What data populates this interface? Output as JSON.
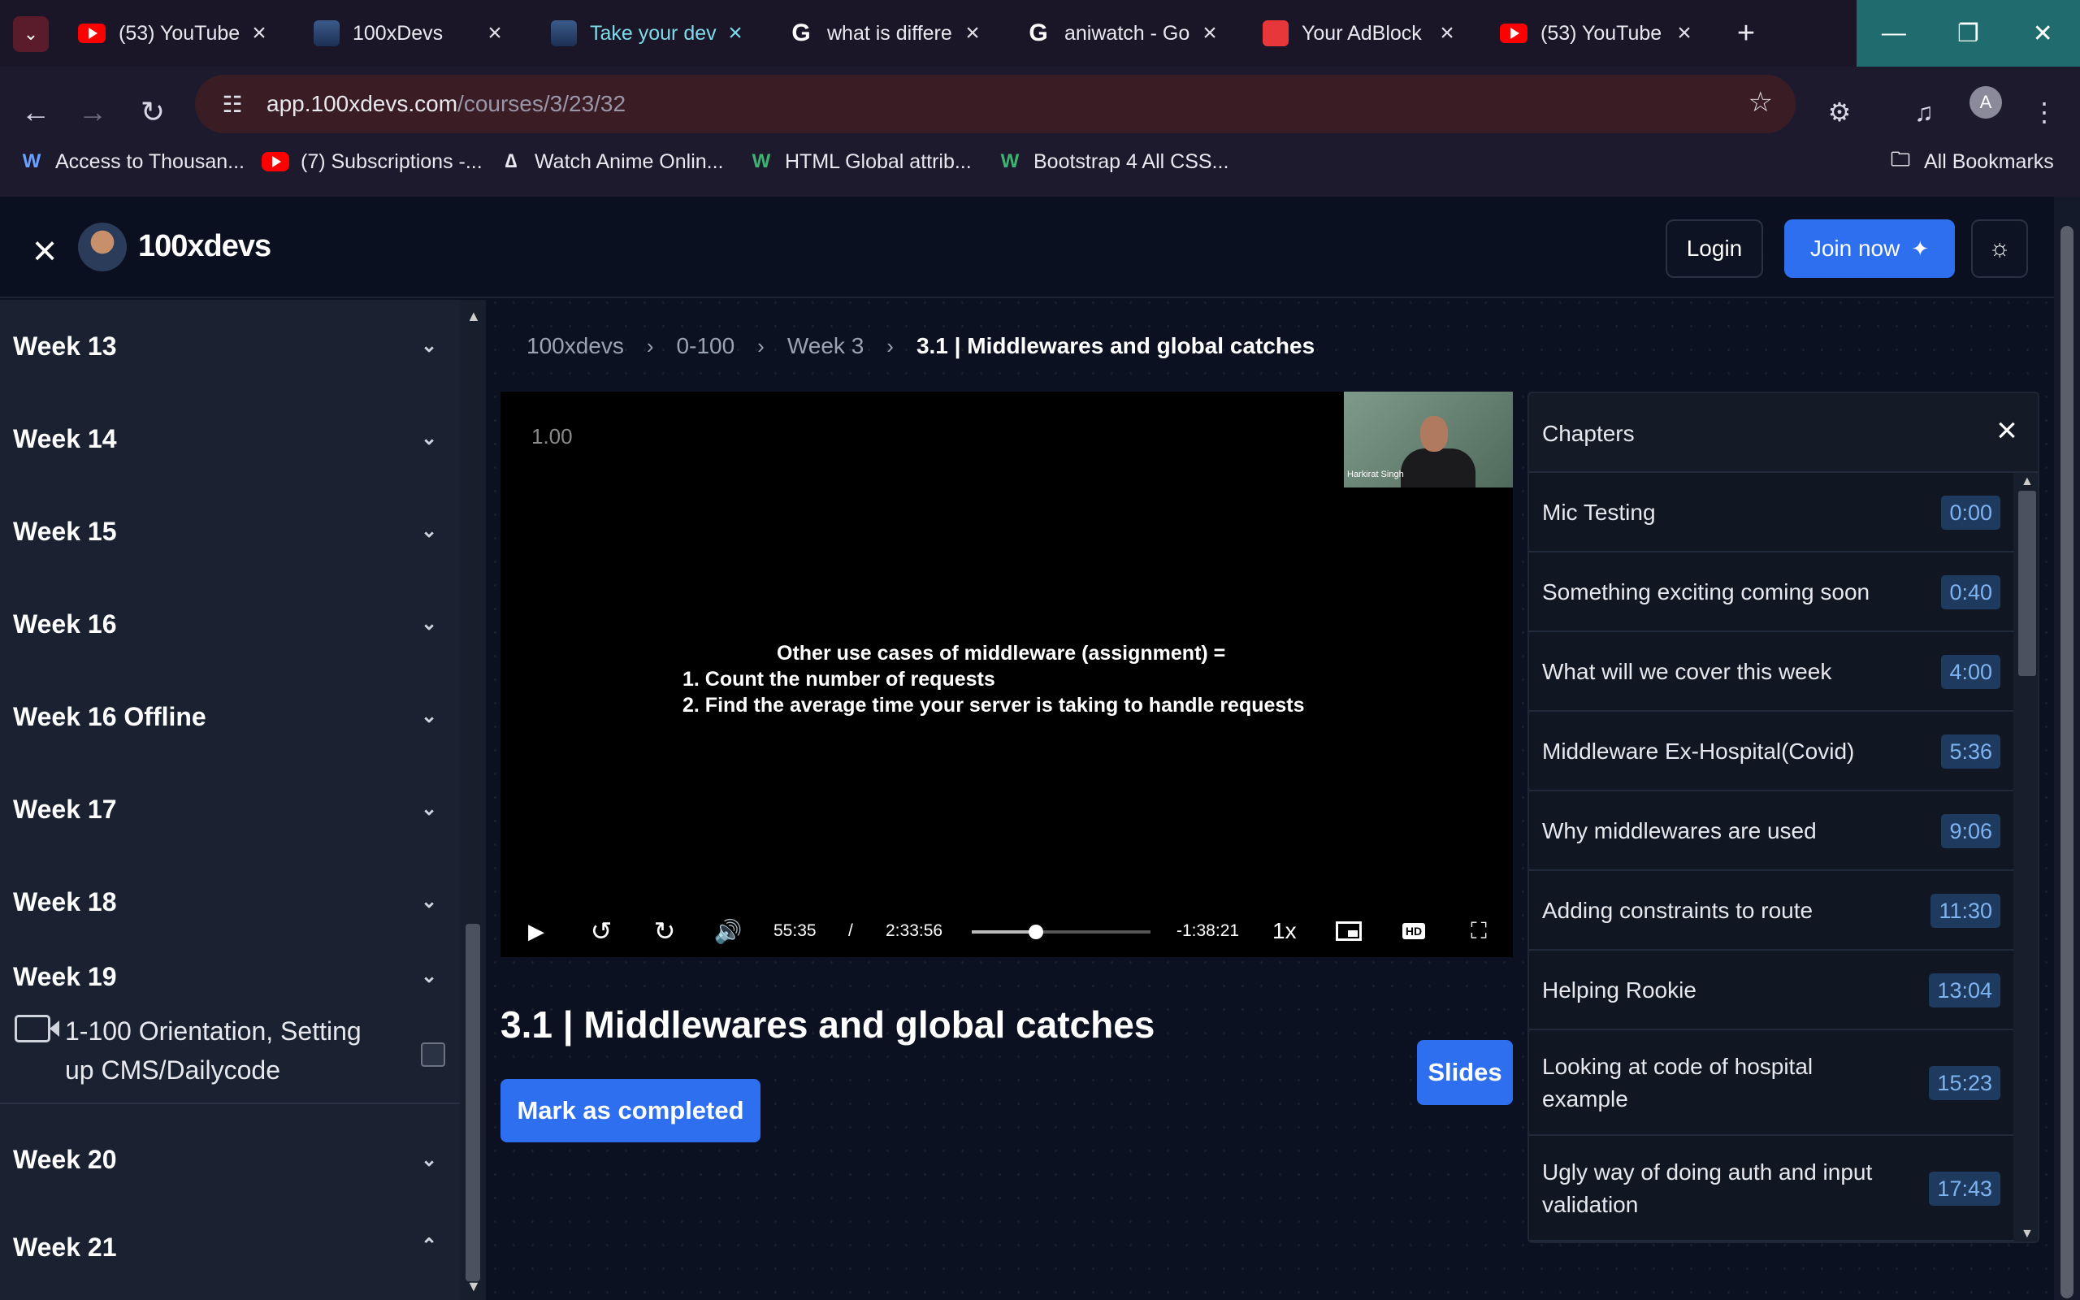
{
  "browser": {
    "tabs": [
      {
        "title": "(53) YouTube",
        "favicon": "youtube-icon"
      },
      {
        "title": "100xDevs",
        "favicon": "avatar-icon"
      },
      {
        "title": "Take your dev",
        "favicon": "avatar-icon",
        "active": true
      },
      {
        "title": "what is differe",
        "favicon": "google-icon"
      },
      {
        "title": "aniwatch - Go",
        "favicon": "google-icon"
      },
      {
        "title": "Your AdBlock",
        "favicon": "adblock-icon"
      },
      {
        "title": "(53) YouTube",
        "favicon": "youtube-icon"
      }
    ],
    "url_host": "app.100xdevs.com",
    "url_path": "/courses/3/23/32",
    "profile_initial": "A",
    "bookmarks": [
      {
        "label": "Access to Thousan...",
        "icon": "w-icon"
      },
      {
        "label": "(7) Subscriptions -...",
        "icon": "youtube-icon"
      },
      {
        "label": "Watch Anime Onlin...",
        "icon": "anime-icon"
      },
      {
        "label": "HTML Global attrib...",
        "icon": "w3-icon"
      },
      {
        "label": "Bootstrap 4 All CSS...",
        "icon": "w3-icon"
      }
    ],
    "all_bookmarks": "All Bookmarks"
  },
  "header": {
    "brand": "100xdevs",
    "login": "Login",
    "join": "Join now"
  },
  "sidebar": {
    "weeks": [
      "Week 13",
      "Week 14",
      "Week 15",
      "Week 16",
      "Week 16 Offline",
      "Week 17",
      "Week 18",
      "Week 19"
    ],
    "lesson": "1-100 Orientation, Setting up CMS/Dailycode",
    "weeks_after": [
      "Week 20",
      "Week 21"
    ]
  },
  "breadcrumb": [
    "100xdevs",
    "0-100",
    "Week 3",
    "3.1 | Middlewares and global catches"
  ],
  "video": {
    "speed_overlay": "1.00",
    "cam_name": "Harkirat Singh",
    "slide_heading": "Other use cases of middleware (assignment) =",
    "slide_items": [
      "1.  Count the number of requests",
      "2.  Find the average time your server is taking to handle requests"
    ],
    "current_time": "55:35",
    "separator": "/",
    "duration": "2:33:56",
    "remaining": "-1:38:21",
    "playback_rate": "1x",
    "progress_fraction": 0.36
  },
  "lesson": {
    "title": "3.1 | Middlewares and global catches",
    "mark_completed": "Mark as completed",
    "slides": "Slides"
  },
  "chapters": {
    "title": "Chapters",
    "items": [
      {
        "label": "Mic Testing",
        "time": "0:00"
      },
      {
        "label": "Something exciting coming soon",
        "time": "0:40"
      },
      {
        "label": "What will we cover this week",
        "time": "4:00"
      },
      {
        "label": "Middleware Ex-Hospital(Covid)",
        "time": "5:36"
      },
      {
        "label": "Why middlewares are used",
        "time": "9:06"
      },
      {
        "label": "Adding constraints to route",
        "time": "11:30"
      },
      {
        "label": "Helping Rookie",
        "time": "13:04"
      },
      {
        "label": "Looking at code of hospital example",
        "time": "15:23"
      },
      {
        "label": "Ugly way of doing auth and input validation",
        "time": "17:43"
      }
    ]
  },
  "colors": {
    "accent": "#2e6ff0",
    "page_bg": "#0b1120",
    "sidebar_bg": "#1a2232",
    "tab_active": "#7fd9e8"
  }
}
